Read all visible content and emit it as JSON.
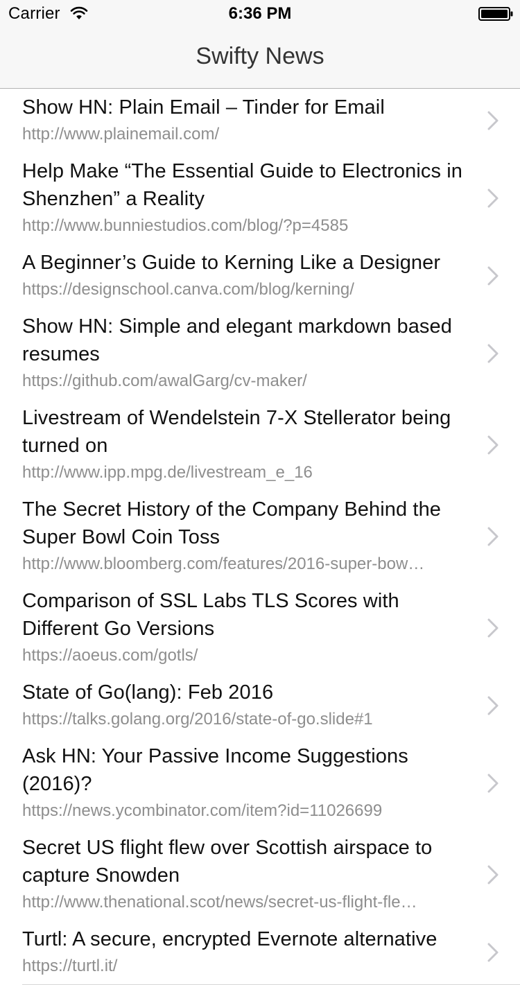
{
  "status_bar": {
    "carrier": "Carrier",
    "time": "6:36 PM"
  },
  "nav": {
    "title": "Swifty News"
  },
  "icons": {
    "wifi": "wifi-icon",
    "battery": "battery-icon",
    "chevron": "chevron-right-icon"
  },
  "colors": {
    "nav_background": "#f7f7f7",
    "url_text": "#8e8e8e",
    "chevron": "#c7c7cc"
  },
  "stories": [
    {
      "title": "Show HN: Plain Email – Tinder for Email",
      "url": "http://www.plainemail.com/"
    },
    {
      "title": "Help Make “The Essential Guide to Electronics in Shenzhen” a Reality",
      "url": "http://www.bunniestudios.com/blog/?p=4585"
    },
    {
      "title": "A Beginner’s Guide to Kerning Like a Designer",
      "url": "https://designschool.canva.com/blog/kerning/"
    },
    {
      "title": "Show HN: Simple and elegant markdown based resumes",
      "url": "https://github.com/awalGarg/cv-maker/"
    },
    {
      "title": "Livestream of Wendelstein 7-X Stellerator being turned on",
      "url": "http://www.ipp.mpg.de/livestream_e_16"
    },
    {
      "title": "The Secret History of the Company Behind the Super Bowl Coin Toss",
      "url": "http://www.bloomberg.com/features/2016-super-bow…"
    },
    {
      "title": "Comparison of SSL Labs TLS Scores with Different Go Versions",
      "url": "https://aoeus.com/gotls/"
    },
    {
      "title": "State of Go(lang): Feb 2016",
      "url": "https://talks.golang.org/2016/state-of-go.slide#1"
    },
    {
      "title": "Ask HN: Your Passive Income Suggestions (2016)?",
      "url": "https://news.ycombinator.com/item?id=11026699"
    },
    {
      "title": "Secret US flight flew over Scottish airspace to capture Snowden",
      "url": "http://www.thenational.scot/news/secret-us-flight-fle…"
    },
    {
      "title": "Turtl: A secure, encrypted Evernote alternative",
      "url": "https://turtl.it/"
    }
  ]
}
